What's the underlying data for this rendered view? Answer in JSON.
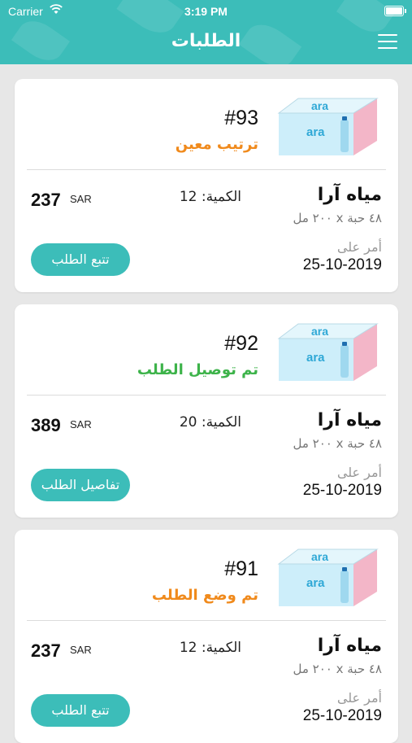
{
  "status_bar": {
    "carrier": "Carrier",
    "time": "3:19 PM"
  },
  "header": {
    "title": "الطلبات"
  },
  "colors": {
    "accent": "#3cbdb9",
    "status_orange": "#f08a1c",
    "status_green": "#3db34a"
  },
  "icons": {
    "menu": "hamburger-menu-icon",
    "wifi": "wifi-icon",
    "battery": "battery-icon"
  },
  "orders": [
    {
      "number": "#93",
      "status": "ترتيب معين",
      "status_color": "#f08a1c",
      "product_name": "مياه آرا",
      "quantity_label": "الكمية: 12",
      "pack": "٤٨ حبة x ٢٠٠ مل",
      "price": "237",
      "currency": "SAR",
      "ordered_label": "أمر على",
      "date": "25-10-2019",
      "button": "تتبع الطلب"
    },
    {
      "number": "#92",
      "status": "تم توصيل الطلب",
      "status_color": "#3db34a",
      "product_name": "مياه آرا",
      "quantity_label": "الكمية: 20",
      "pack": "٤٨ حبة x ٢٠٠ مل",
      "price": "389",
      "currency": "SAR",
      "ordered_label": "أمر على",
      "date": "25-10-2019",
      "button": "تفاصيل الطلب"
    },
    {
      "number": "#91",
      "status": "تم وضع الطلب",
      "status_color": "#f08a1c",
      "product_name": "مياه آرا",
      "quantity_label": "الكمية: 12",
      "pack": "٤٨ حبة x ٢٠٠ مل",
      "price": "237",
      "currency": "SAR",
      "ordered_label": "أمر على",
      "date": "25-10-2019",
      "button": "تتبع الطلب"
    }
  ]
}
